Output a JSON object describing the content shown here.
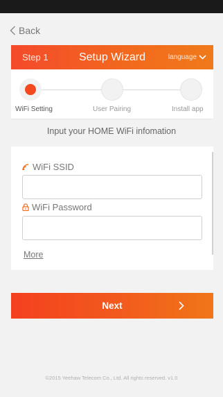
{
  "nav": {
    "back_label": "Back"
  },
  "wizard": {
    "step_label": "Step 1",
    "title": "Setup Wizard",
    "language_label": "language"
  },
  "progress": {
    "steps": [
      {
        "label": "WiFi Setting"
      },
      {
        "label": "User Pairing"
      },
      {
        "label": "Install app"
      }
    ],
    "current_step": 1
  },
  "instruction": "Input your HOME WiFi infomation",
  "form": {
    "ssid_label": "WiFi SSID",
    "ssid_value": "",
    "password_label": "WiFi Password",
    "password_value": "",
    "more_label": "More"
  },
  "actions": {
    "next_label": "Next"
  },
  "footer": "©2015 Yeehaw Telecom Co., Ltd. All rights reserved. v1.0",
  "colors": {
    "accent": "#f2491f",
    "accent_end": "#f07a1a",
    "background": "#f2f2f2"
  }
}
